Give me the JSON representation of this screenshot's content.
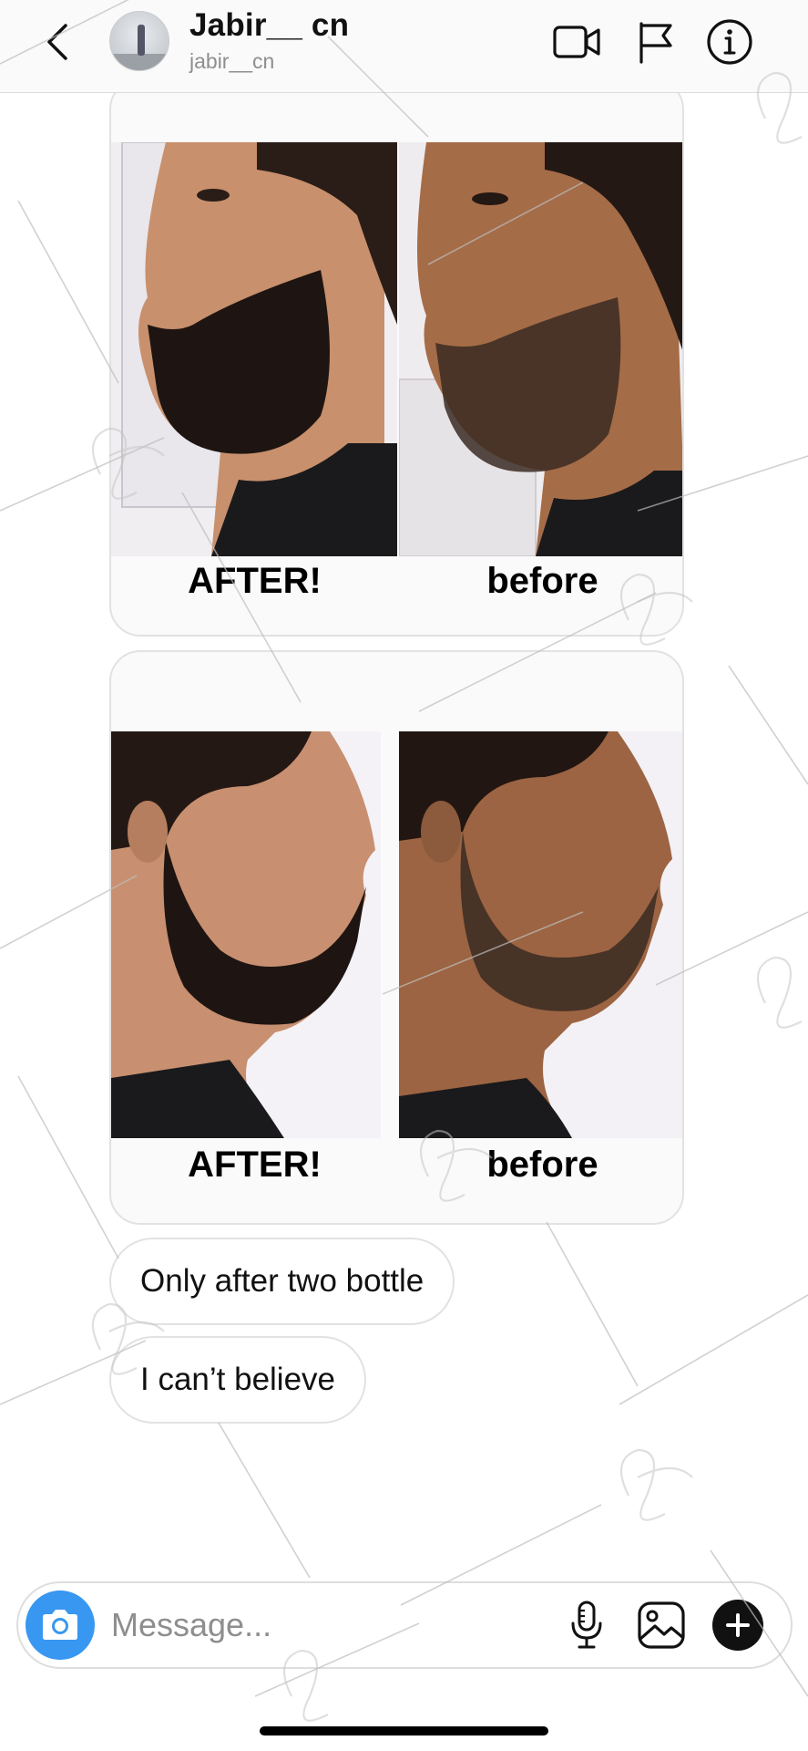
{
  "header": {
    "title": "Jabir__ cn",
    "subtitle": "jabir__cn"
  },
  "messages": [
    {
      "type": "media",
      "captions": [
        "AFTER!",
        "before"
      ]
    },
    {
      "type": "media",
      "captions": [
        "AFTER!",
        "before"
      ]
    },
    {
      "type": "text",
      "text": "Only after two bottle"
    },
    {
      "type": "text",
      "text": "I can’t believe"
    }
  ],
  "composer": {
    "placeholder": "Message..."
  },
  "icons": {
    "back": "chevron-left-icon",
    "video": "video-call-icon",
    "report": "flag-icon",
    "info": "info-icon",
    "camera": "camera-icon",
    "mic": "microphone-icon",
    "gallery": "gallery-icon",
    "more": "plus-icon"
  },
  "colors": {
    "accent": "#3897f0",
    "bubble_border": "#e2e2e2",
    "secondary_text": "#8e8e8e"
  }
}
